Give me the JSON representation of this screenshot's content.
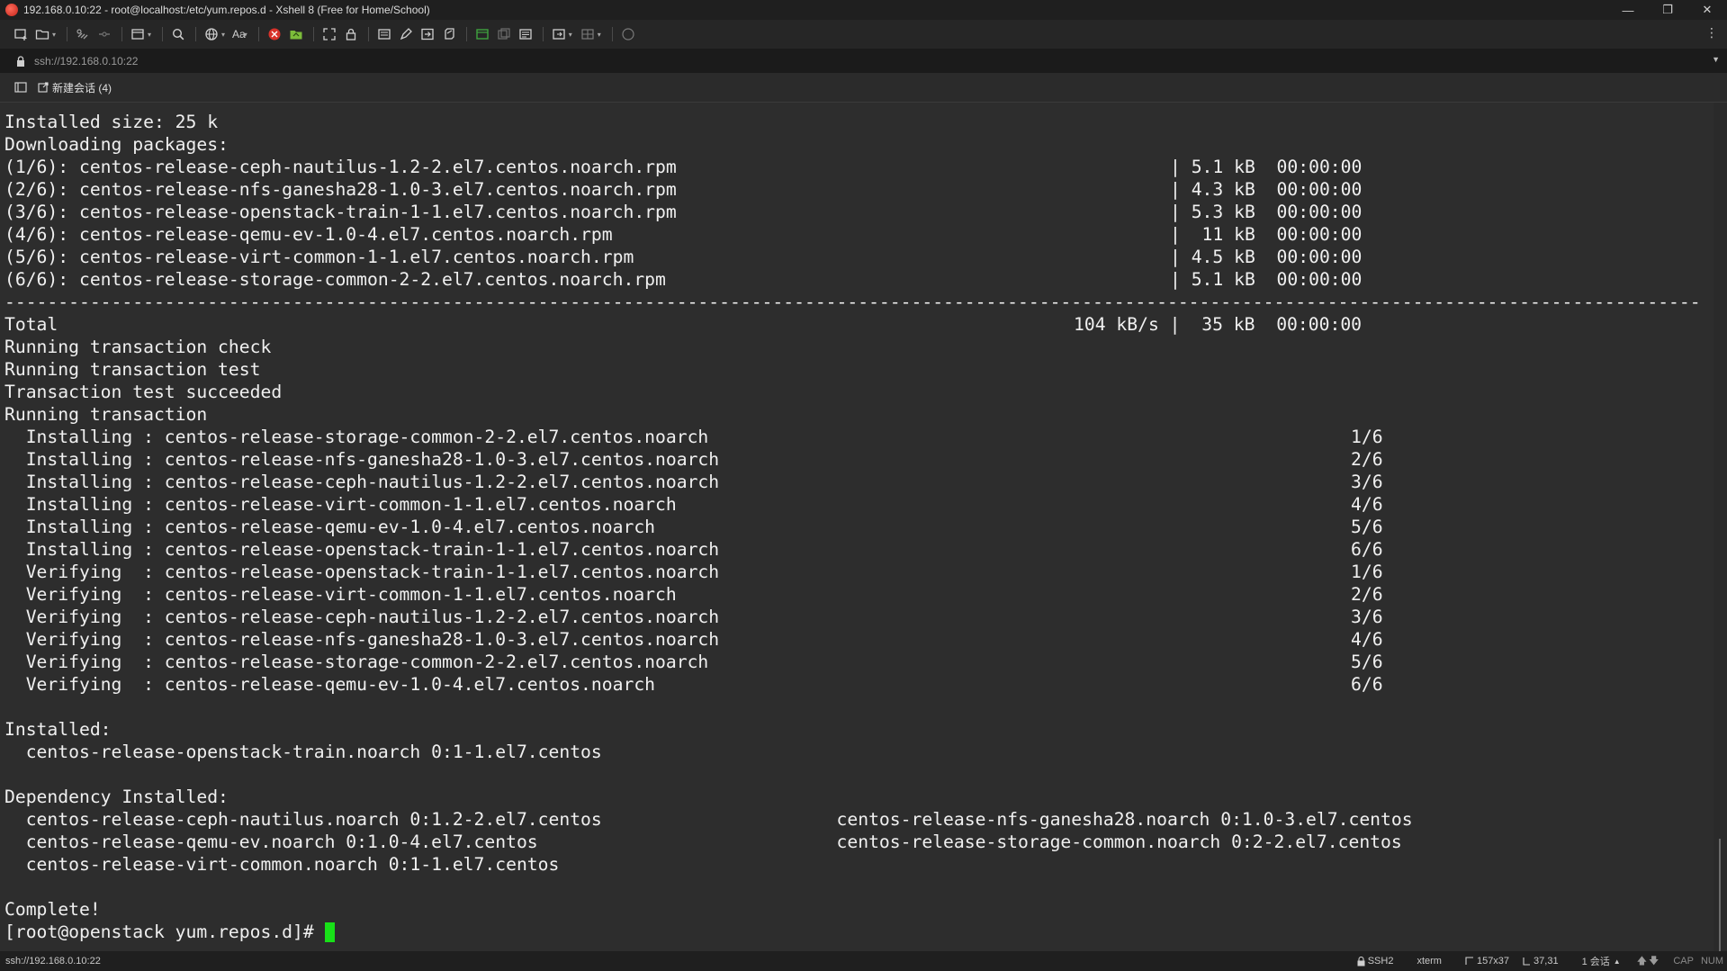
{
  "window": {
    "title": "192.168.0.10:22 - root@localhost:/etc/yum.repos.d - Xshell 8 (Free for Home/School)",
    "controls": [
      "—",
      "❐",
      "✕"
    ]
  },
  "toolbar": {
    "font_label": "Aa",
    "icons": [
      "new-session-icon",
      "open-folder-icon",
      "reconnect-icon",
      "disconnect-icon",
      "new-tab-icon",
      "find-icon",
      "globe-icon",
      "font-icon",
      "xshell-red-icon",
      "xftp-green-icon",
      "fullscreen-icon",
      "lock-icon",
      "compose-icon",
      "highlight-icon",
      "transfer-icon",
      "script-icon",
      "new-window-icon",
      "duplicate-icon",
      "log-icon",
      "tile-icon",
      "layout-icon",
      "chat-icon"
    ]
  },
  "address_bar": {
    "value": "ssh://192.168.0.10:22"
  },
  "tabs": {
    "session_tab_label": "新建会话 (4)"
  },
  "terminal": {
    "lines": [
      {
        "l": "Installed size: 25 k",
        "r": ""
      },
      {
        "l": "Downloading packages:",
        "r": ""
      },
      {
        "l": "(1/6): centos-release-ceph-nautilus-1.2-2.el7.centos.noarch.rpm",
        "r": "| 5.1 kB  00:00:00"
      },
      {
        "l": "(2/6): centos-release-nfs-ganesha28-1.0-3.el7.centos.noarch.rpm",
        "r": "| 4.3 kB  00:00:00"
      },
      {
        "l": "(3/6): centos-release-openstack-train-1-1.el7.centos.noarch.rpm",
        "r": "| 5.3 kB  00:00:00"
      },
      {
        "l": "(4/6): centos-release-qemu-ev-1.0-4.el7.centos.noarch.rpm",
        "r": "|  11 kB  00:00:00"
      },
      {
        "l": "(5/6): centos-release-virt-common-1-1.el7.centos.noarch.rpm",
        "r": "| 4.5 kB  00:00:00"
      },
      {
        "l": "(6/6): centos-release-storage-common-2-2.el7.centos.noarch.rpm",
        "r": "| 5.1 kB  00:00:00"
      },
      {
        "l": "---------------------------------------------------------------------------------------------------------------------------------------------------------------",
        "r": ""
      },
      {
        "l": "Total",
        "r": "104 kB/s |  35 kB  00:00:00"
      },
      {
        "l": "Running transaction check",
        "r": ""
      },
      {
        "l": "Running transaction test",
        "r": ""
      },
      {
        "l": "Transaction test succeeded",
        "r": ""
      },
      {
        "l": "Running transaction",
        "r": ""
      },
      {
        "l": "  Installing : centos-release-storage-common-2-2.el7.centos.noarch",
        "r": "1/6"
      },
      {
        "l": "  Installing : centos-release-nfs-ganesha28-1.0-3.el7.centos.noarch",
        "r": "2/6"
      },
      {
        "l": "  Installing : centos-release-ceph-nautilus-1.2-2.el7.centos.noarch",
        "r": "3/6"
      },
      {
        "l": "  Installing : centos-release-virt-common-1-1.el7.centos.noarch",
        "r": "4/6"
      },
      {
        "l": "  Installing : centos-release-qemu-ev-1.0-4.el7.centos.noarch",
        "r": "5/6"
      },
      {
        "l": "  Installing : centos-release-openstack-train-1-1.el7.centos.noarch",
        "r": "6/6"
      },
      {
        "l": "  Verifying  : centos-release-openstack-train-1-1.el7.centos.noarch",
        "r": "1/6"
      },
      {
        "l": "  Verifying  : centos-release-virt-common-1-1.el7.centos.noarch",
        "r": "2/6"
      },
      {
        "l": "  Verifying  : centos-release-ceph-nautilus-1.2-2.el7.centos.noarch",
        "r": "3/6"
      },
      {
        "l": "  Verifying  : centos-release-nfs-ganesha28-1.0-3.el7.centos.noarch",
        "r": "4/6"
      },
      {
        "l": "  Verifying  : centos-release-storage-common-2-2.el7.centos.noarch",
        "r": "5/6"
      },
      {
        "l": "  Verifying  : centos-release-qemu-ev-1.0-4.el7.centos.noarch",
        "r": "6/6"
      },
      {
        "l": "",
        "r": ""
      },
      {
        "l": "Installed:",
        "r": ""
      },
      {
        "l": "  centos-release-openstack-train.noarch 0:1-1.el7.centos",
        "r": ""
      },
      {
        "l": "",
        "r": ""
      },
      {
        "l": "Dependency Installed:",
        "r": ""
      },
      {
        "l": "  centos-release-ceph-nautilus.noarch 0:1.2-2.el7.centos                      centos-release-nfs-ganesha28.noarch 0:1.0-3.el7.centos",
        "r": ""
      },
      {
        "l": "  centos-release-qemu-ev.noarch 0:1.0-4.el7.centos                            centos-release-storage-common.noarch 0:2-2.el7.centos",
        "r": ""
      },
      {
        "l": "  centos-release-virt-common.noarch 0:1-1.el7.centos",
        "r": ""
      },
      {
        "l": "",
        "r": ""
      },
      {
        "l": "Complete!",
        "r": ""
      }
    ],
    "prompt": "[root@openstack yum.repos.d]# ",
    "cursor_color": "#18e018"
  },
  "status_bar": {
    "connection": "ssh://192.168.0.10:22",
    "protocol": "SSH2",
    "terminal_type": "xterm",
    "size": "157x37",
    "cursor_pos": "37,31",
    "sessions": "1 会话",
    "cap": "CAP",
    "num": "NUM"
  },
  "colors": {
    "terminal_bg": "#2d2d2d",
    "terminal_fg": "#f0f0f0",
    "titlebar_bg": "#1f1f1f"
  }
}
